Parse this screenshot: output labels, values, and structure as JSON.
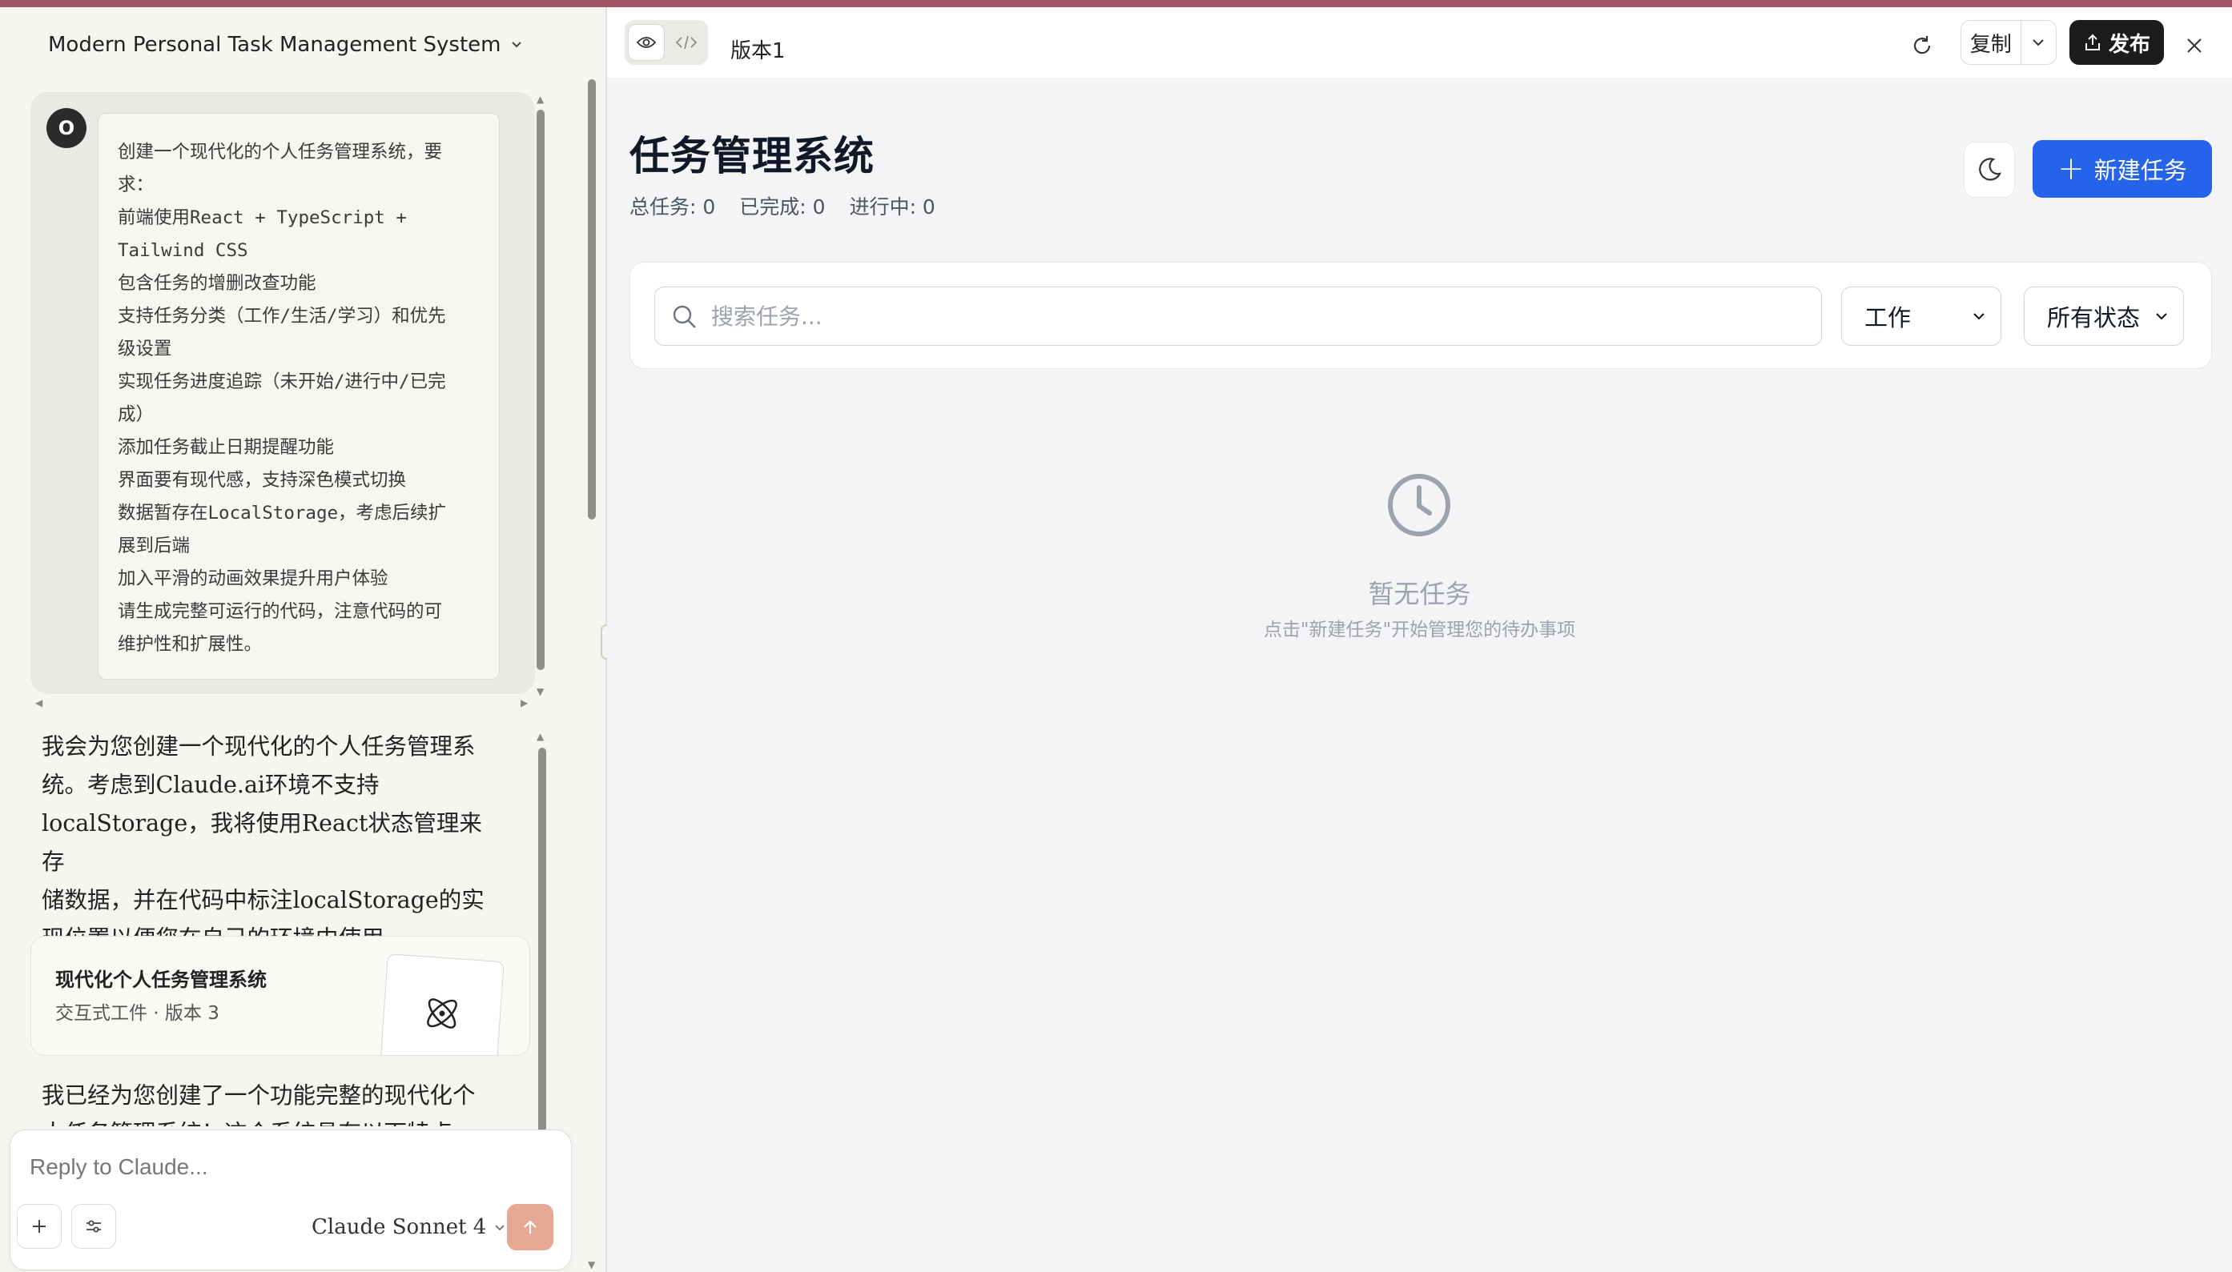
{
  "chat": {
    "title": "Modern Personal Task Management System",
    "user_initial": "O",
    "prompt_lines": [
      "创建一个现代化的个人任务管理系统，要",
      "求：",
      "前端使用React + TypeScript +",
      "Tailwind CSS",
      "包含任务的增删改查功能",
      "支持任务分类（工作/生活/学习）和优先",
      "级设置",
      "实现任务进度追踪（未开始/进行中/已完",
      "成）",
      "添加任务截止日期提醒功能",
      "界面要有现代感，支持深色模式切换",
      "数据暂存在LocalStorage，考虑后续扩",
      "展到后端",
      "加入平滑的动画效果提升用户体验",
      "请生成完整可运行的代码，注意代码的可",
      "维护性和扩展性。"
    ],
    "assistant_lines": [
      "我会为您创建一个现代化的个人任务管理系",
      "统。考虑到Claude.ai环境不支持",
      "localStorage，我将使用React状态管理来存",
      "储数据，并在代码中标注localStorage的实",
      "现位置以便您在自己的环境中使用。"
    ],
    "artifact": {
      "title": "现代化个人任务管理系统",
      "subtitle": "交互式工件 · 版本 3",
      "icon": "react-atom-icon"
    },
    "assistant_line2": "我已经为您创建了一个功能完整的现代化个",
    "assistant_line3": "人任务管理系统！这个系统具有以下特点",
    "composer": {
      "placeholder": "Reply to Claude...",
      "model": "Claude Sonnet 4"
    }
  },
  "preview": {
    "version_label": "版本1",
    "copy_label": "复制",
    "publish_label": "发布",
    "app": {
      "title": "任务管理系统",
      "stats": [
        "总任务: 0",
        "已完成: 0",
        "进行中: 0"
      ],
      "new_task_label": "新建任务",
      "search_placeholder": "搜索任务...",
      "category_value": "工作",
      "status_value": "所有状态",
      "empty_title": "暂无任务",
      "empty_sub": "点击\"新建任务\"开始管理您的待办事项"
    }
  },
  "colors": {
    "accent": "#2563eb",
    "topbar": "#a05464",
    "send": "#e4a893"
  }
}
